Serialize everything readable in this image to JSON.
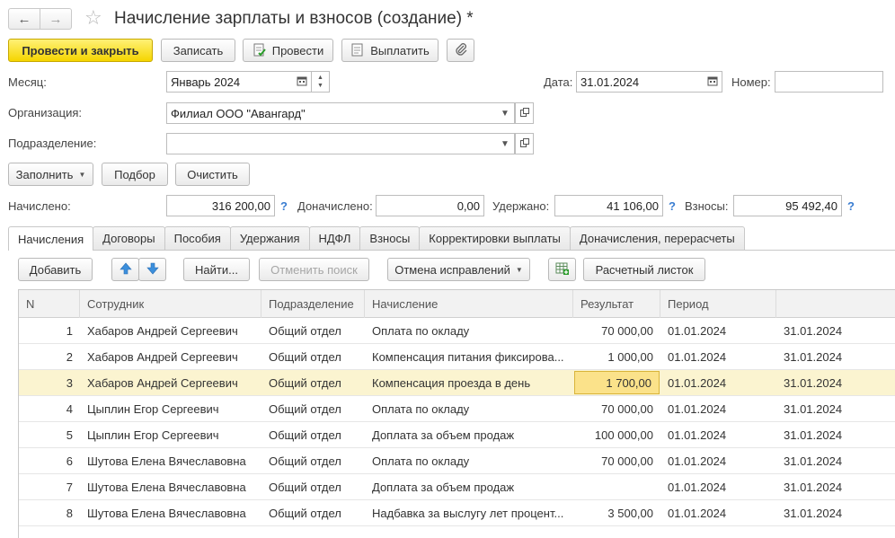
{
  "window": {
    "title": "Начисление зарплаты и взносов (создание) *"
  },
  "toolbar": {
    "post_close": "Провести и закрыть",
    "save": "Записать",
    "post": "Провести",
    "pay": "Выплатить"
  },
  "form": {
    "month_label": "Месяц:",
    "month_value": "Январь 2024",
    "date_label": "Дата:",
    "date_value": "31.01.2024",
    "number_label": "Номер:",
    "number_value": "",
    "org_label": "Организация:",
    "org_value": "Филиал ООО \"Авангард\"",
    "dept_label": "Подразделение:",
    "dept_value": ""
  },
  "actions": {
    "fill": "Заполнить",
    "pick": "Подбор",
    "clear": "Очистить"
  },
  "totals": {
    "accrued_label": "Начислено:",
    "accrued_value": "316 200,00",
    "extra_label": "Доначислено:",
    "extra_value": "0,00",
    "withheld_label": "Удержано:",
    "withheld_value": "41 106,00",
    "contrib_label": "Взносы:",
    "contrib_value": "95 492,40",
    "help": "?"
  },
  "tabs": [
    "Начисления",
    "Договоры",
    "Пособия",
    "Удержания",
    "НДФЛ",
    "Взносы",
    "Корректировки выплаты",
    "Доначисления, перерасчеты"
  ],
  "table_toolbar": {
    "add": "Добавить",
    "find": "Найти...",
    "cancel_search": "Отменить поиск",
    "cancel_fix": "Отмена исправлений",
    "payslip": "Расчетный листок"
  },
  "table": {
    "columns": [
      "N",
      "Сотрудник",
      "Подразделение",
      "Начисление",
      "Результат",
      "Период",
      ""
    ],
    "rows": [
      {
        "n": "1",
        "employee": "Хабаров Андрей Сергеевич",
        "dept": "Общий отдел",
        "accrual": "Оплата по окладу",
        "result": "70 000,00",
        "from": "01.01.2024",
        "to": "31.01.2024"
      },
      {
        "n": "2",
        "employee": "Хабаров Андрей Сергеевич",
        "dept": "Общий отдел",
        "accrual": "Компенсация питания фиксирова...",
        "result": "1 000,00",
        "from": "01.01.2024",
        "to": "31.01.2024"
      },
      {
        "n": "3",
        "employee": "Хабаров Андрей Сергеевич",
        "dept": "Общий отдел",
        "accrual": "Компенсация проезда в день",
        "result": "1 700,00",
        "from": "01.01.2024",
        "to": "31.01.2024"
      },
      {
        "n": "4",
        "employee": "Цыплин Егор Сергеевич",
        "dept": "Общий отдел",
        "accrual": "Оплата по окладу",
        "result": "70 000,00",
        "from": "01.01.2024",
        "to": "31.01.2024"
      },
      {
        "n": "5",
        "employee": "Цыплин Егор Сергеевич",
        "dept": "Общий отдел",
        "accrual": "Доплата за объем продаж",
        "result": "100 000,00",
        "from": "01.01.2024",
        "to": "31.01.2024"
      },
      {
        "n": "6",
        "employee": "Шутова Елена Вячеславовна",
        "dept": "Общий отдел",
        "accrual": "Оплата по окладу",
        "result": "70 000,00",
        "from": "01.01.2024",
        "to": "31.01.2024"
      },
      {
        "n": "7",
        "employee": "Шутова Елена Вячеславовна",
        "dept": "Общий отдел",
        "accrual": "Доплата за объем продаж",
        "result": "",
        "from": "01.01.2024",
        "to": "31.01.2024"
      },
      {
        "n": "8",
        "employee": "Шутова Елена Вячеславовна",
        "dept": "Общий отдел",
        "accrual": "Надбавка за выслугу лет процент...",
        "result": "3 500,00",
        "from": "01.01.2024",
        "to": "31.01.2024"
      }
    ],
    "selected_row": 3
  },
  "icons": {
    "back": "arrow-left-icon",
    "forward": "arrow-right-icon",
    "favorite": "star-icon",
    "post": "post-document-icon",
    "pay": "pay-document-icon",
    "attach": "paperclip-icon",
    "calendar": "calendar-icon",
    "up": "arrow-up-icon",
    "down": "arrow-down-icon",
    "spreadsheet": "spreadsheet-add-icon"
  },
  "colors": {
    "primary_button": "#f5d500",
    "selected_row": "#fbf4d0",
    "focused_cell": "#fbe28a",
    "help_blue": "#3a7dd1"
  }
}
